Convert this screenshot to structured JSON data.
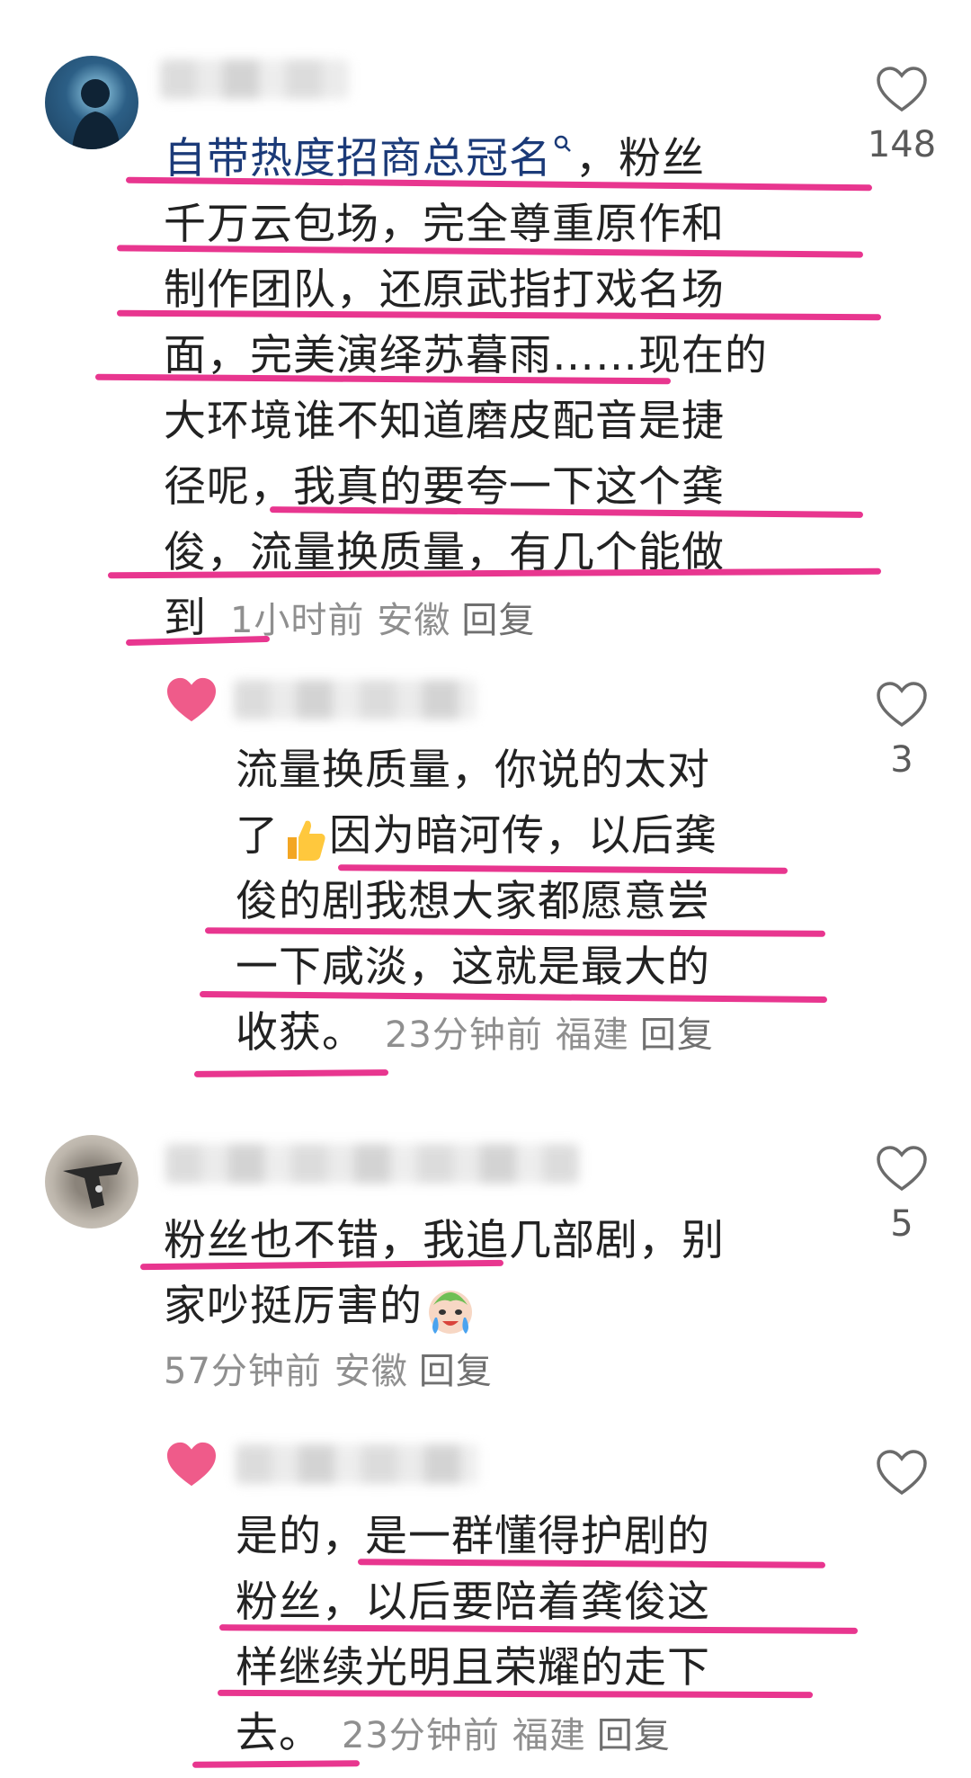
{
  "comments": [
    {
      "topic": "自带热度招商总冠名",
      "line1_rest": "，粉丝",
      "lines": [
        "千万云包场，完全尊重原作和",
        "制作团队，还原武指打戏名场",
        "面，完美演绎苏暮雨……现在的",
        "大环境谁不知道磨皮配音是捷",
        "径呢，我真的要夸一下这个龚",
        "俊，流量换质量，有几个能做"
      ],
      "last": "到",
      "time": "1小时前",
      "location": "安徽",
      "reply": "回复",
      "likes": "148"
    },
    {
      "lines": [
        "流量换质量，你说的太对"
      ],
      "line2a": "了",
      "line2b": "因为暗河传，以后龚",
      "lines2": [
        "俊的剧我想大家都愿意尝",
        "一下咸淡，这就是最大的"
      ],
      "last": "收获。",
      "time": "23分钟前",
      "location": "福建",
      "reply": "回复",
      "likes": "3"
    },
    {
      "lines": [
        "粉丝也不错，我追几部剧，别"
      ],
      "line2": "家吵挺厉害的",
      "time": "57分钟前",
      "location": "安徽",
      "reply": "回复",
      "likes": "5"
    },
    {
      "lines": [
        "是的，是一群懂得护剧的",
        "粉丝，以后要陪着龚俊这",
        "样继续光明且荣耀的走下"
      ],
      "last": "去。",
      "time": "23分钟前",
      "location": "福建",
      "reply": "回复",
      "likes": ""
    }
  ],
  "icons": {
    "like": "heart-outline-icon",
    "search": "search-icon",
    "thumbs": "thumbs-up-emoji",
    "cry": "crying-emoji"
  },
  "colors": {
    "highlight": "#e8368f",
    "topic": "#1b3a78",
    "meta": "#8f8f8f"
  }
}
